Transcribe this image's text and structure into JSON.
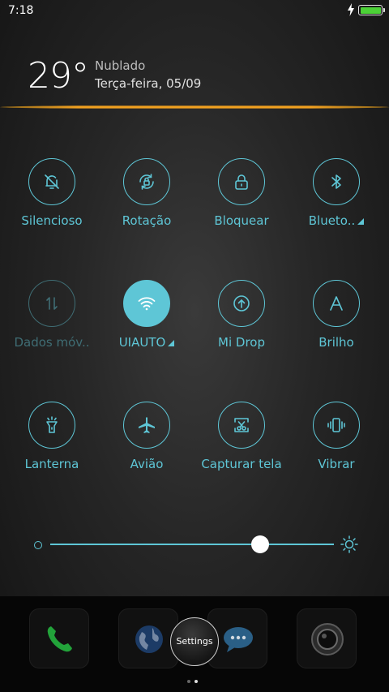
{
  "status_bar": {
    "time": "7:18",
    "battery_level": 1.0
  },
  "weather": {
    "temperature": "29°",
    "condition": "Nublado",
    "date": "Terça-feira, 05/09"
  },
  "toggles": [
    {
      "label": "Silencioso",
      "icon": "bell-off-icon",
      "state": "off"
    },
    {
      "label": "Rotação",
      "icon": "rotation-lock-icon",
      "state": "off"
    },
    {
      "label": "Bloquear",
      "icon": "lock-icon",
      "state": "off"
    },
    {
      "label": "Blueto..",
      "icon": "bluetooth-icon",
      "state": "off",
      "expandable": true
    },
    {
      "label": "Dados móv..",
      "icon": "mobile-data-icon",
      "state": "disabled"
    },
    {
      "label": "UIAUTO",
      "icon": "wifi-icon",
      "state": "on",
      "expandable": true
    },
    {
      "label": "Mi Drop",
      "icon": "mi-drop-icon",
      "state": "off"
    },
    {
      "label": "Brilho",
      "icon": "auto-brightness-icon",
      "state": "off"
    },
    {
      "label": "Lanterna",
      "icon": "flashlight-icon",
      "state": "off"
    },
    {
      "label": "Avião",
      "icon": "airplane-icon",
      "state": "off"
    },
    {
      "label": "Capturar tela",
      "icon": "screenshot-icon",
      "state": "off"
    },
    {
      "label": "Vibrar",
      "icon": "vibrate-icon",
      "state": "off"
    }
  ],
  "brightness": {
    "level": 0.74
  },
  "dock": {
    "apps": [
      "phone-icon",
      "browser-icon",
      "messages-icon",
      "camera-icon"
    ],
    "settings_bubble": "Settings",
    "page_indicator": {
      "pages": 2,
      "current": 2
    }
  },
  "colors": {
    "accent": "#5ec6d6",
    "divider": "#f0a020",
    "battery": "#4cd137"
  }
}
